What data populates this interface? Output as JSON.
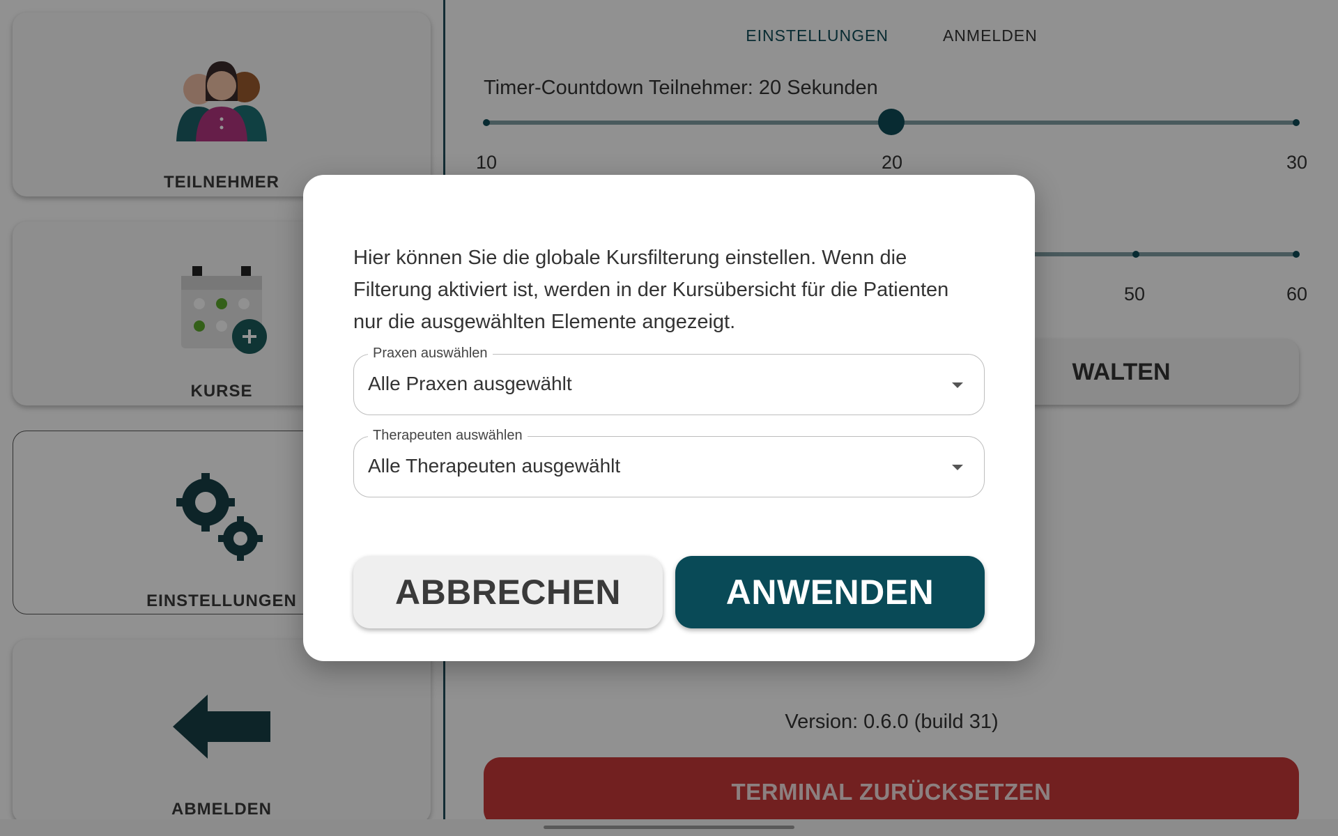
{
  "sidebar": {
    "items": [
      {
        "label": "TEILNEHMER",
        "icon": "participants-icon"
      },
      {
        "label": "KURSE",
        "icon": "calendar-add-icon"
      },
      {
        "label": "EINSTELLUNGEN",
        "icon": "gears-icon",
        "active": true
      },
      {
        "label": "ABMELDEN",
        "icon": "arrow-left-icon"
      }
    ]
  },
  "tabs": [
    {
      "label": "EINSTELLUNGEN",
      "active": true
    },
    {
      "label": "ANMELDEN",
      "active": false
    }
  ],
  "timer_slider": {
    "title": "Timer-Countdown Teilnehmer: 20 Sekunden",
    "min_label": "10",
    "mid_label": "20",
    "max_label": "30",
    "value": 20,
    "min": 10,
    "max": 30
  },
  "second_slider": {
    "tick_labels": [
      "50",
      "60"
    ]
  },
  "manage_button": {
    "label_visible": "WALTEN"
  },
  "version": "Version: 0.6.0 (build 31)",
  "reset_button": {
    "label": "TERMINAL ZURÜCKSETZEN"
  },
  "colors": {
    "primary": "#094a57",
    "danger": "#c53737",
    "overlay": "rgba(0,0,0,0.42)"
  },
  "dialog": {
    "text": "Hier können Sie die globale Kursfilterung einstellen. Wenn die Filterung aktiviert ist, werden in der Kursübersicht für die Patienten nur die ausgewählten Elemente angezeigt.",
    "practices": {
      "label": "Praxen auswählen",
      "value": "Alle Praxen ausgewählt"
    },
    "therapists": {
      "label": "Therapeuten auswählen",
      "value": "Alle Therapeuten ausgewählt"
    },
    "cancel_label": "ABBRECHEN",
    "apply_label": "ANWENDEN"
  }
}
